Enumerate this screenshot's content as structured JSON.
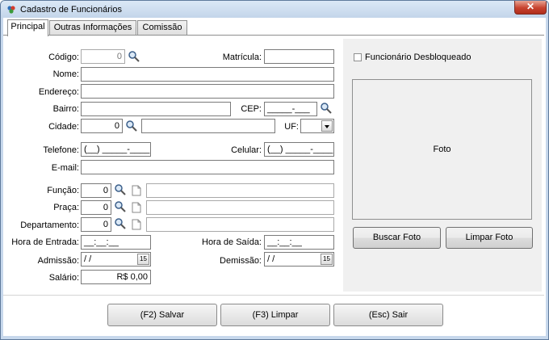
{
  "window": {
    "title": "Cadastro de Funcionários"
  },
  "tabs": [
    {
      "label": "Principal"
    },
    {
      "label": "Outras Informações"
    },
    {
      "label": "Comissão"
    }
  ],
  "form": {
    "codigo": {
      "label": "Código:",
      "value": "0"
    },
    "matricula": {
      "label": "Matrícula:",
      "value": ""
    },
    "nome": {
      "label": "Nome:",
      "value": ""
    },
    "endereco": {
      "label": "Endereço:",
      "value": ""
    },
    "bairro": {
      "label": "Bairro:",
      "value": ""
    },
    "cep": {
      "label": "CEP:",
      "value": "_____-___"
    },
    "cidade": {
      "label": "Cidade:",
      "code": "0",
      "name": ""
    },
    "uf": {
      "label": "UF:",
      "value": ""
    },
    "telefone": {
      "label": "Telefone:",
      "value": "(__) _____-____"
    },
    "celular": {
      "label": "Celular:",
      "value": "(__) _____-____"
    },
    "email": {
      "label": "E-mail:",
      "value": ""
    },
    "funcao": {
      "label": "Função:",
      "code": "0",
      "name": ""
    },
    "praca": {
      "label": "Praça:",
      "code": "0",
      "name": ""
    },
    "departamento": {
      "label": "Departamento:",
      "code": "0",
      "name": ""
    },
    "hora_entrada": {
      "label": "Hora de Entrada:",
      "value": "__:__:__"
    },
    "hora_saida": {
      "label": "Hora de Saída:",
      "value": "__:__:__"
    },
    "admissao": {
      "label": "Admissão:",
      "value": "/  /"
    },
    "demissao": {
      "label": "Demissão:",
      "value": "/  /"
    },
    "salario": {
      "label": "Salário:",
      "value": "R$ 0,00"
    },
    "calendar_glyph": "15"
  },
  "side": {
    "desbloqueado_label": "Funcionário Desbloqueado",
    "foto_label": "Foto",
    "buscar_foto": "Buscar Foto",
    "limpar_foto": "Limpar Foto"
  },
  "footer": {
    "salvar": "(F2) Salvar",
    "limpar": "(F3) Limpar",
    "sair": "(Esc) Sair"
  },
  "colors": {
    "titlebar": "#c7d8ec",
    "close": "#c7432f",
    "panel": "#f0f0f0"
  }
}
